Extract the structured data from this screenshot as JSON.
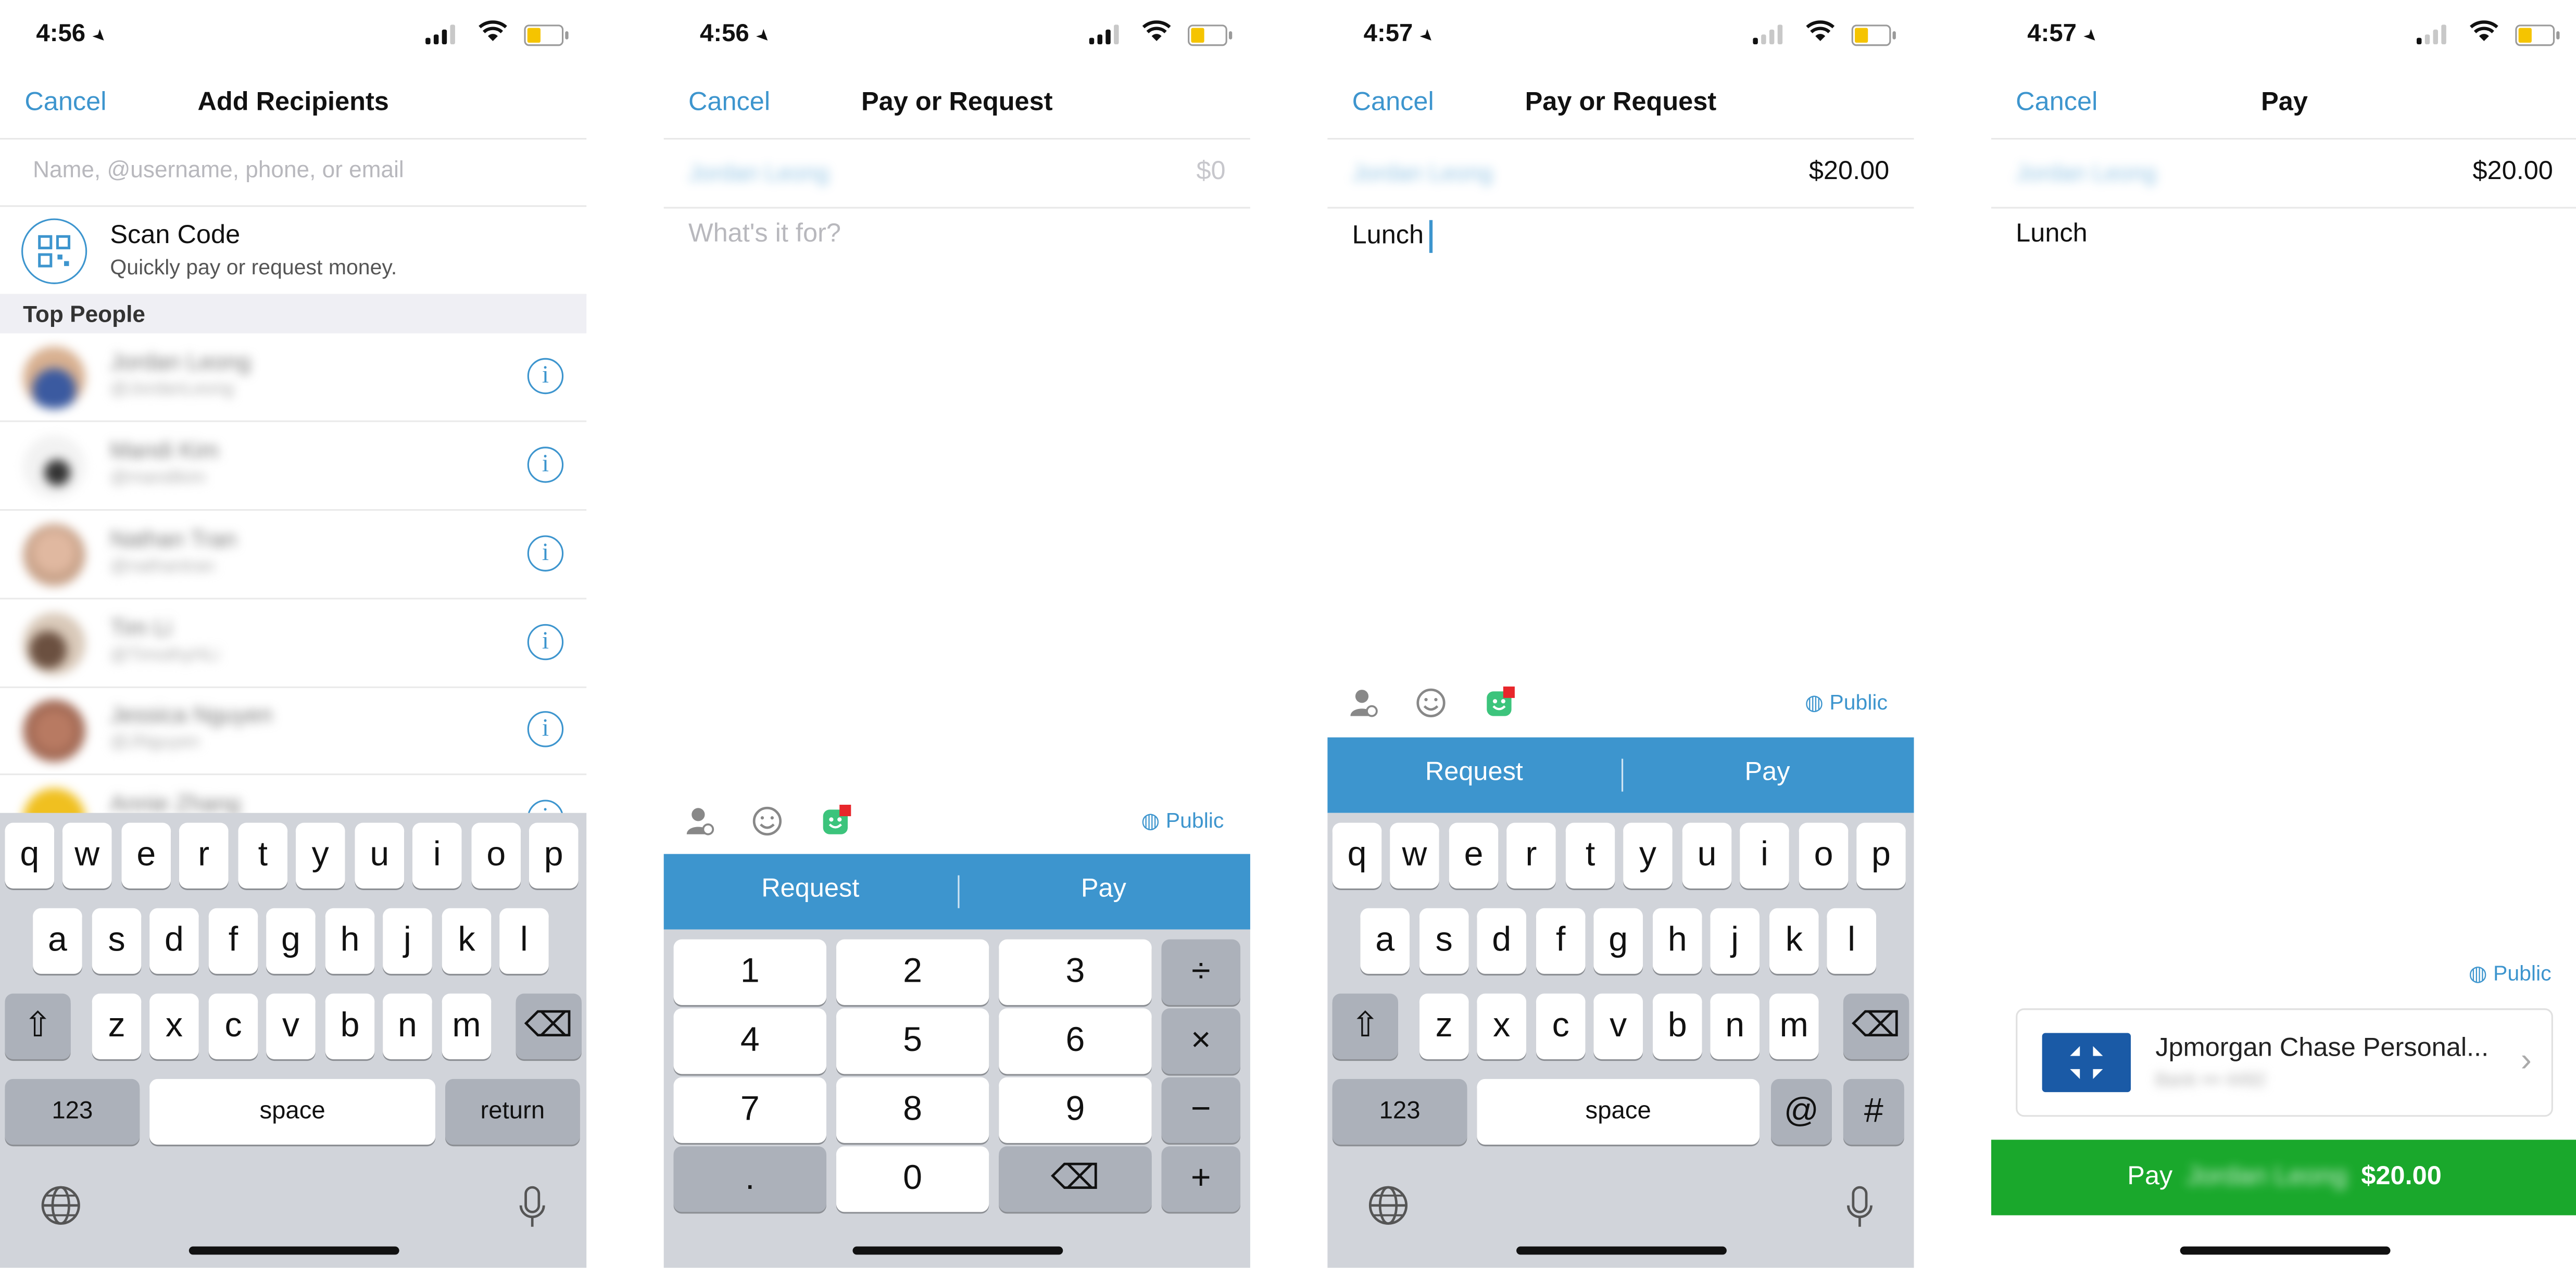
{
  "status_times": [
    "4:56",
    "4:56",
    "4:57",
    "4:57"
  ],
  "common": {
    "cancel": "Cancel",
    "public": "Public",
    "request": "Request",
    "pay": "Pay"
  },
  "screen1": {
    "title": "Add Recipients",
    "search_placeholder": "Name, @username, phone, or email",
    "scan_title": "Scan Code",
    "scan_subtitle": "Quickly pay or request money.",
    "section": "Top People",
    "people": [
      {
        "name": "Jordan Leong",
        "username": "@JordanLeong"
      },
      {
        "name": "Mandi Kim",
        "username": "@mandikim"
      },
      {
        "name": "Nathan Tran",
        "username": "@nathantran"
      },
      {
        "name": "Tim Li",
        "username": "@TimothyHLi"
      },
      {
        "name": "Jessica Nguyen",
        "username": "@JNguyen"
      },
      {
        "name": "Annie Zhang",
        "username": ""
      }
    ],
    "keyboard": {
      "row1": [
        "q",
        "w",
        "e",
        "r",
        "t",
        "y",
        "u",
        "i",
        "o",
        "p"
      ],
      "row2": [
        "a",
        "s",
        "d",
        "f",
        "g",
        "h",
        "j",
        "k",
        "l"
      ],
      "row3": [
        "z",
        "x",
        "c",
        "v",
        "b",
        "n",
        "m"
      ],
      "num": "123",
      "space": "space",
      "return": "return"
    }
  },
  "screen2": {
    "title": "Pay or Request",
    "recipient": "Jordan Leong",
    "amount": "$0",
    "note_placeholder": "What's it for?",
    "numpad": {
      "rows": [
        [
          "1",
          "2",
          "3"
        ],
        [
          "4",
          "5",
          "6"
        ],
        [
          "7",
          "8",
          "9"
        ],
        [
          ".",
          "0",
          ""
        ]
      ],
      "ops": [
        "÷",
        "×",
        "−",
        "+"
      ]
    }
  },
  "screen3": {
    "title": "Pay or Request",
    "recipient": "Jordan Leong",
    "amount": "$20.00",
    "note": "Lunch",
    "keyboard": {
      "row1": [
        "q",
        "w",
        "e",
        "r",
        "t",
        "y",
        "u",
        "i",
        "o",
        "p"
      ],
      "row2": [
        "a",
        "s",
        "d",
        "f",
        "g",
        "h",
        "j",
        "k",
        "l"
      ],
      "row3": [
        "z",
        "x",
        "c",
        "v",
        "b",
        "n",
        "m"
      ],
      "num": "123",
      "space": "space",
      "at": "@",
      "hash": "#"
    }
  },
  "screen4": {
    "title": "Pay",
    "recipient": "Jordan Leong",
    "amount": "$20.00",
    "note": "Lunch",
    "bank_name": "Jpmorgan Chase Personal...",
    "bank_sub": "Bank ••• 4492",
    "pay_prefix": "Pay",
    "pay_name": "Jordan Leong",
    "pay_amount": "$20.00"
  },
  "colors": {
    "venmo_blue": "#3d95ce",
    "pay_green": "#1aa82c",
    "keyboard_bg": "#d1d4da"
  }
}
